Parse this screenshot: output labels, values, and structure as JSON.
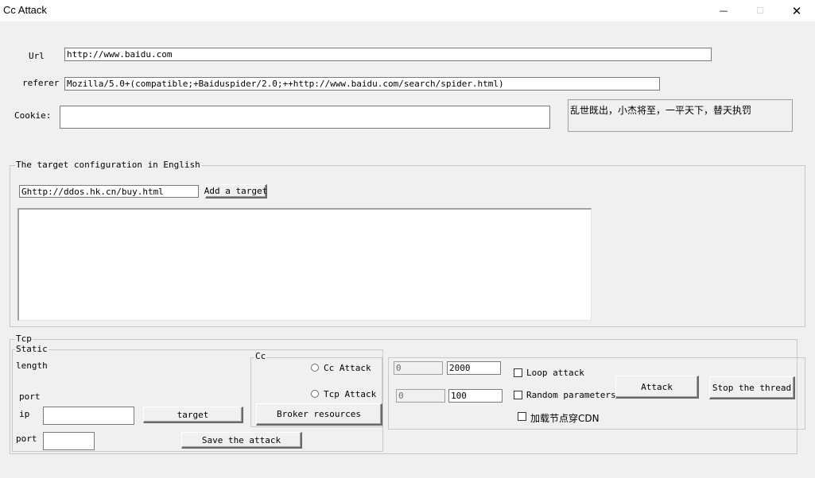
{
  "window": {
    "title": "Cc Attack",
    "minimize_glyph": "—",
    "maximize_glyph": "☐",
    "close_glyph": "✕"
  },
  "form": {
    "url_label": "Url",
    "url_value": "http://www.baidu.com",
    "referer_label": "referer",
    "referer_value": "Mozilla/5.0+(compatible;+Baiduspider/2.0;++http://www.baidu.com/search/spider.html)",
    "cookie_label": "Cookie:",
    "cookie_value": "",
    "slogan": "乱世既出，小杰将至，一平天下，替天执罚"
  },
  "target_config": {
    "legend": "The target configuration in English",
    "target_input_value": "Ghttp://ddos.hk.cn/buy.html",
    "add_button": "Add a target",
    "target_list": ""
  },
  "tcp": {
    "legend": "Tcp",
    "static_legend": "Static",
    "length_label": "length",
    "port_label_top": "port",
    "ip_label": "ip",
    "ip_value": "",
    "port_label": "port",
    "port_value": "",
    "target_button": "target",
    "save_button": "Save the attack"
  },
  "cc": {
    "legend": "Cc",
    "cc_attack_label": "Cc  Attack",
    "tcp_attack_label": "Tcp  Attack",
    "broker_button": "Broker resources"
  },
  "params": {
    "field1_disabled": "0",
    "field1_value": "2000",
    "field2_disabled": "0",
    "field2_value": "100",
    "loop_attack_label": "Loop attack",
    "random_params_label": "Random parameters",
    "cdn_label": "加载节点穿CDN",
    "attack_button": "Attack",
    "stop_button": "Stop the thread"
  }
}
